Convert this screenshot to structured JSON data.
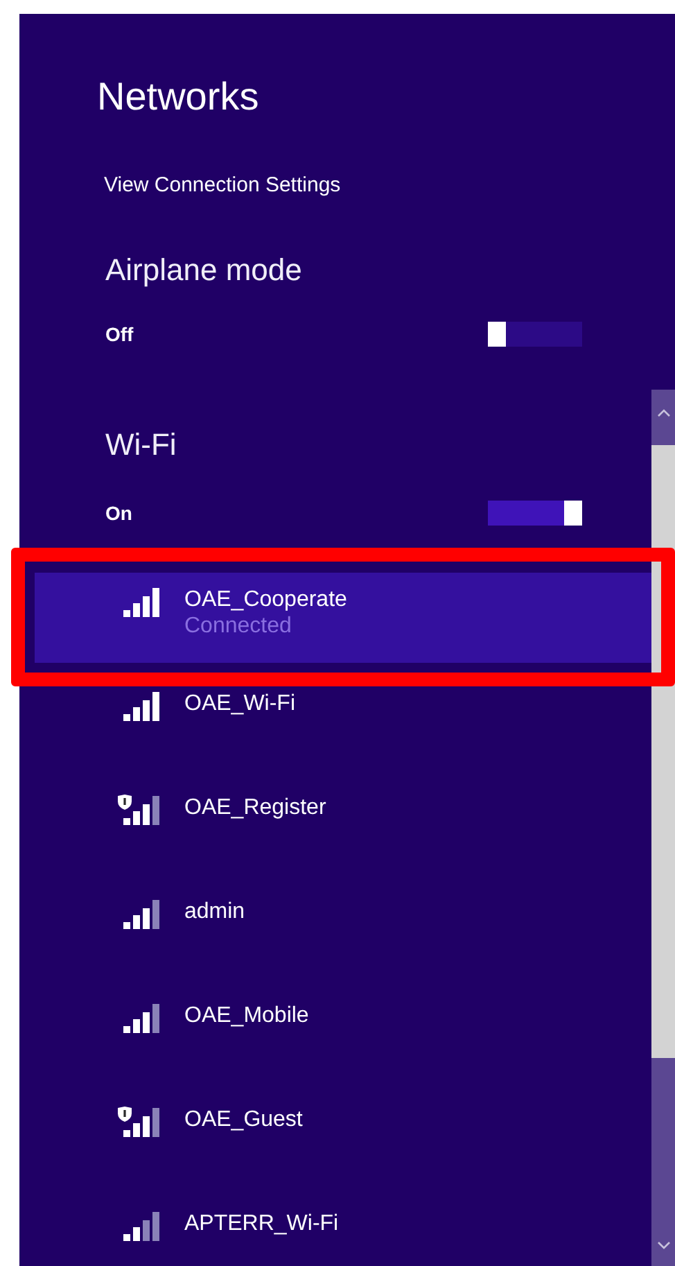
{
  "title": "Networks",
  "settings_link": "View Connection Settings",
  "airplane_mode": {
    "heading": "Airplane mode",
    "state_label": "Off",
    "on": false
  },
  "wifi": {
    "heading": "Wi-Fi",
    "state_label": "On",
    "on": true
  },
  "networks": [
    {
      "name": "OAE_Cooperate",
      "status": "Connected",
      "selected": true,
      "highlighted": true,
      "kind": "full",
      "shield": false
    },
    {
      "name": "OAE_Wi-Fi",
      "selected": false,
      "highlighted": false,
      "kind": "full",
      "shield": false
    },
    {
      "name": "OAE_Register",
      "selected": false,
      "highlighted": false,
      "kind": "good",
      "shield": true
    },
    {
      "name": "admin",
      "selected": false,
      "highlighted": false,
      "kind": "good",
      "shield": false
    },
    {
      "name": "OAE_Mobile",
      "selected": false,
      "highlighted": false,
      "kind": "good",
      "shield": false
    },
    {
      "name": "OAE_Guest",
      "selected": false,
      "highlighted": false,
      "kind": "good",
      "shield": true
    },
    {
      "name": "APTERR_Wi-Fi",
      "selected": false,
      "highlighted": false,
      "kind": "fair",
      "shield": false
    }
  ]
}
